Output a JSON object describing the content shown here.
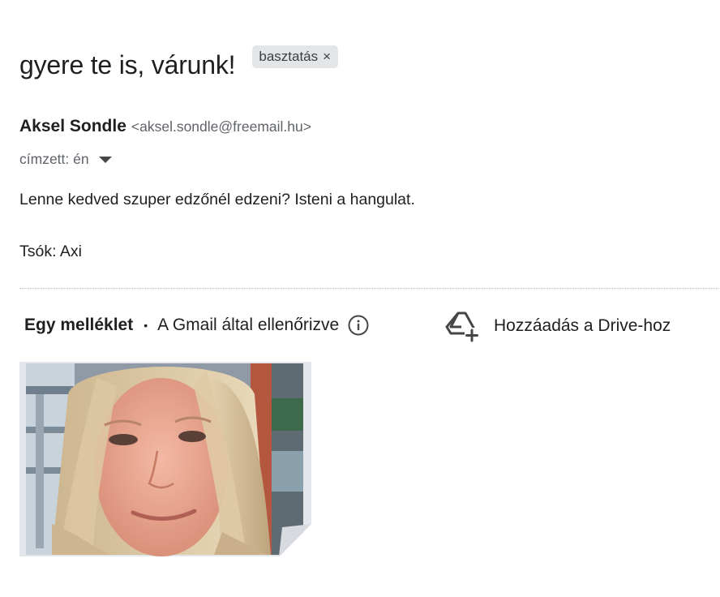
{
  "message": {
    "subject": "gyere te is, várunk!",
    "label_chip": {
      "text": "basztatás",
      "remove_glyph": "×"
    },
    "sender": {
      "name": "Aksel Sondle",
      "email": "<aksel.sondle@freemail.hu>"
    },
    "recipient": "címzett: én",
    "body_lines": [
      "Lenne kedved szuper edzőnél edzeni? Isteni a hangulat.",
      "Tsók: Axi"
    ]
  },
  "attachments": {
    "count_label": "Egy melléklet",
    "separator": "•",
    "scanned_label": "A Gmail által ellenőrizve",
    "info_icon": "info-icon",
    "drive_action_label": "Hozzáadás a Drive-hoz",
    "drive_icon": "add-to-drive-icon",
    "items": [
      {
        "type": "image",
        "preview": "photo of a woman with long blonde hair"
      }
    ]
  },
  "colors": {
    "chip_bg": "#e4e5e7",
    "text_primary": "#1f1f1f",
    "text_secondary": "#5f6368"
  }
}
